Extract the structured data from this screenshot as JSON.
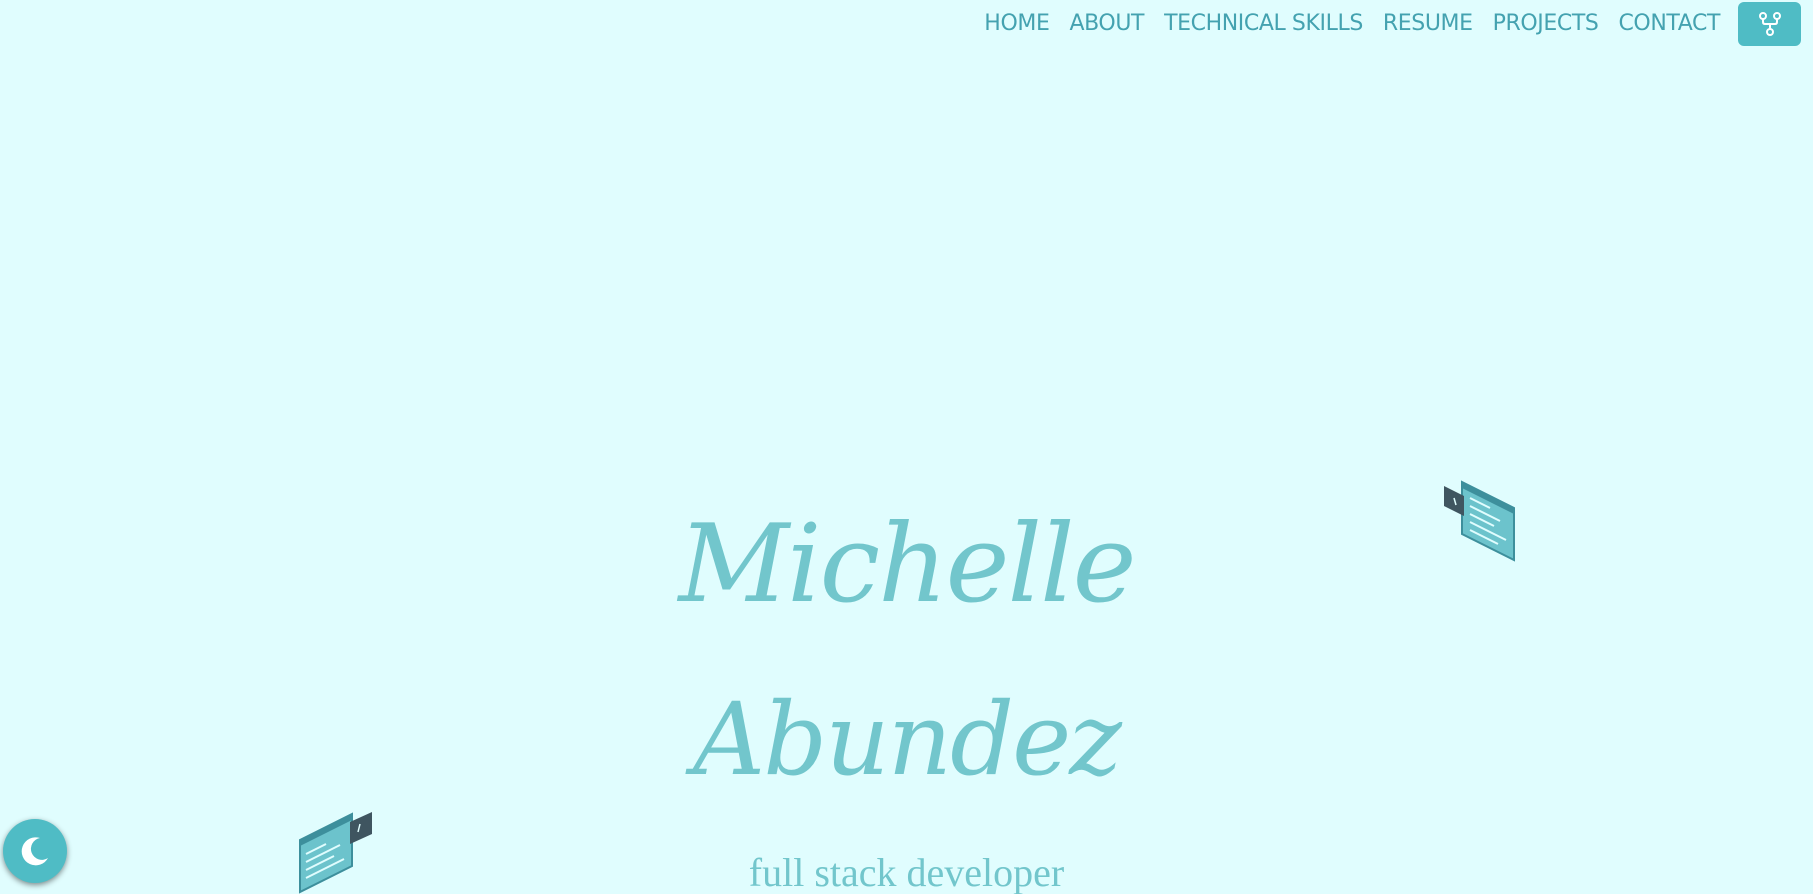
{
  "nav": {
    "items": [
      {
        "label": "HOME"
      },
      {
        "label": "ABOUT"
      },
      {
        "label": "TECHNICAL SKILLS"
      },
      {
        "label": "RESUME"
      },
      {
        "label": "PROJECTS"
      },
      {
        "label": "CONTACT"
      }
    ],
    "fork_icon": "fork-icon"
  },
  "hero": {
    "first_name": "Michelle",
    "last_name": "Abundez",
    "subtitle": "full stack developer"
  },
  "decorations": {
    "icon": "code-window-icon"
  },
  "theme_toggle": {
    "icon": "moon-icon"
  },
  "colors": {
    "background": "#e0fdfe",
    "accent": "#4fbcc5",
    "nav_text": "#44a2b0",
    "hero_text": "#72c6cc",
    "dark_panel": "#3f5560"
  }
}
